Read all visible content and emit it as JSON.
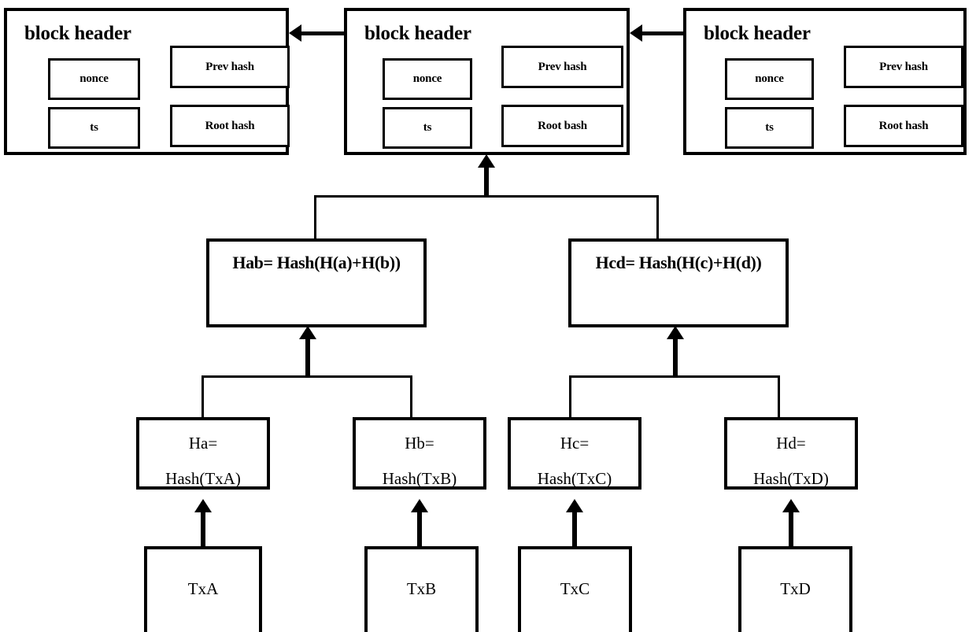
{
  "diagram": {
    "title": "Blockchain block headers with Merkle tree",
    "colors": {
      "stroke": "#000000",
      "background": "#ffffff"
    }
  },
  "blocks": [
    {
      "id": "block-1",
      "header_label": "block header",
      "fields": {
        "nonce": "nonce",
        "ts": "ts",
        "prev_hash": "Prev hash",
        "root_hash": "Root hash"
      }
    },
    {
      "id": "block-2",
      "header_label": "block header",
      "fields": {
        "nonce": "nonce",
        "ts": "ts",
        "prev_hash": "Prev hash",
        "root_hash": "Root bash"
      }
    },
    {
      "id": "block-3",
      "header_label": "block header",
      "fields": {
        "nonce": "nonce",
        "ts": "ts",
        "prev_hash": "Prev hash",
        "root_hash": "Root hash"
      }
    }
  ],
  "merkle": {
    "internal_nodes": [
      {
        "id": "hab",
        "label": "Hab= Hash(H(a)+H(b))"
      },
      {
        "id": "hcd",
        "label": "Hcd= Hash(H(c)+H(d))"
      }
    ],
    "leaf_nodes": [
      {
        "id": "ha",
        "line1": "Ha=",
        "line2": "Hash(TxA)"
      },
      {
        "id": "hb",
        "line1": "Hb=",
        "line2": "Hash(TxB)"
      },
      {
        "id": "hc",
        "line1": "Hc=",
        "line2": "Hash(TxC)"
      },
      {
        "id": "hd",
        "line1": "Hd=",
        "line2": "Hash(TxD)"
      }
    ],
    "transactions": [
      {
        "id": "txa",
        "label": "TxA"
      },
      {
        "id": "txb",
        "label": "TxB"
      },
      {
        "id": "txc",
        "label": "TxC"
      },
      {
        "id": "txd",
        "label": "TxD"
      }
    ]
  }
}
